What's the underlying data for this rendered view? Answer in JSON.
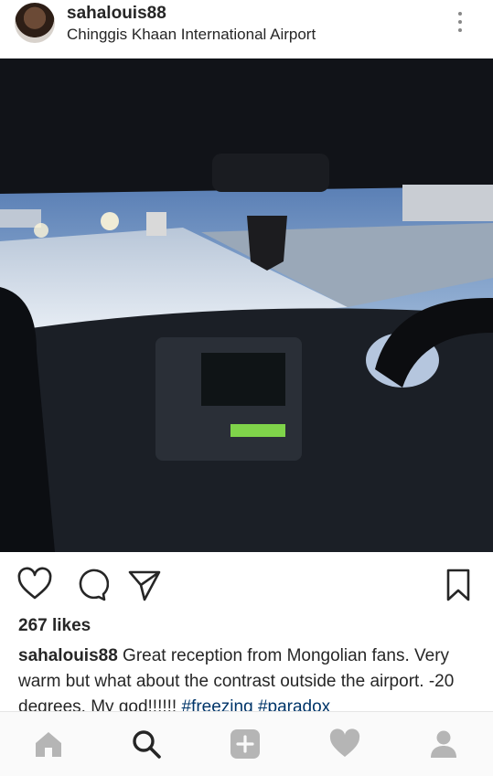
{
  "post": {
    "username": "sahalouis88",
    "location": "Chinggis Khaan International Airport",
    "likes_text": "267 likes",
    "caption_user": "sahalouis88",
    "caption_text": " Great reception from Mongolian fans. Very warm but what about the contrast outside the airport. -20 degrees. My god!!!!!! ",
    "hashtags": [
      "#freezing",
      "#paradox"
    ]
  },
  "icons": {
    "header": [
      "avatar",
      "more-options-icon"
    ],
    "actions": [
      "heart-icon",
      "comment-icon",
      "share-icon",
      "bookmark-icon"
    ],
    "bottom_nav": [
      "home-icon",
      "search-icon",
      "add-icon",
      "activity-heart-icon",
      "profile-icon"
    ]
  },
  "colors": {
    "text": "#262626",
    "hashtag": "#003569",
    "nav_inactive": "#b5b5b5",
    "nav_active": "#262626"
  }
}
